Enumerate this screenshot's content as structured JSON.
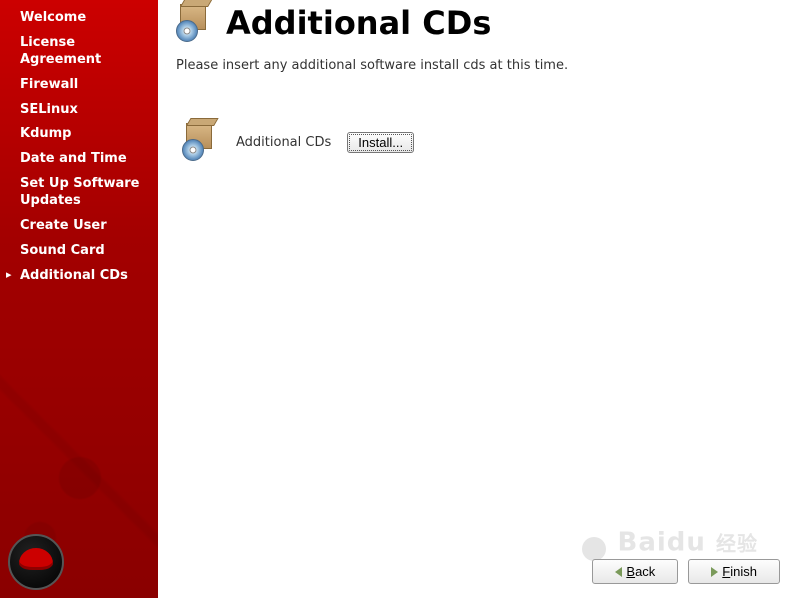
{
  "sidebar": {
    "items": [
      {
        "label": "Welcome"
      },
      {
        "label": "License Agreement"
      },
      {
        "label": "Firewall"
      },
      {
        "label": "SELinux"
      },
      {
        "label": "Kdump"
      },
      {
        "label": "Date and Time"
      },
      {
        "label": "Set Up Software Updates"
      },
      {
        "label": "Create User"
      },
      {
        "label": "Sound Card"
      },
      {
        "label": "Additional CDs"
      }
    ],
    "activeIndex": 9
  },
  "header": {
    "title": "Additional CDs"
  },
  "description": "Please insert any additional software install cds at this time.",
  "install_section": {
    "label": "Additional CDs",
    "button_label": "Install..."
  },
  "footer": {
    "back_label": "Back",
    "finish_label": "Finish"
  },
  "watermark": {
    "brand": "Baidu",
    "suffix": "经验"
  }
}
